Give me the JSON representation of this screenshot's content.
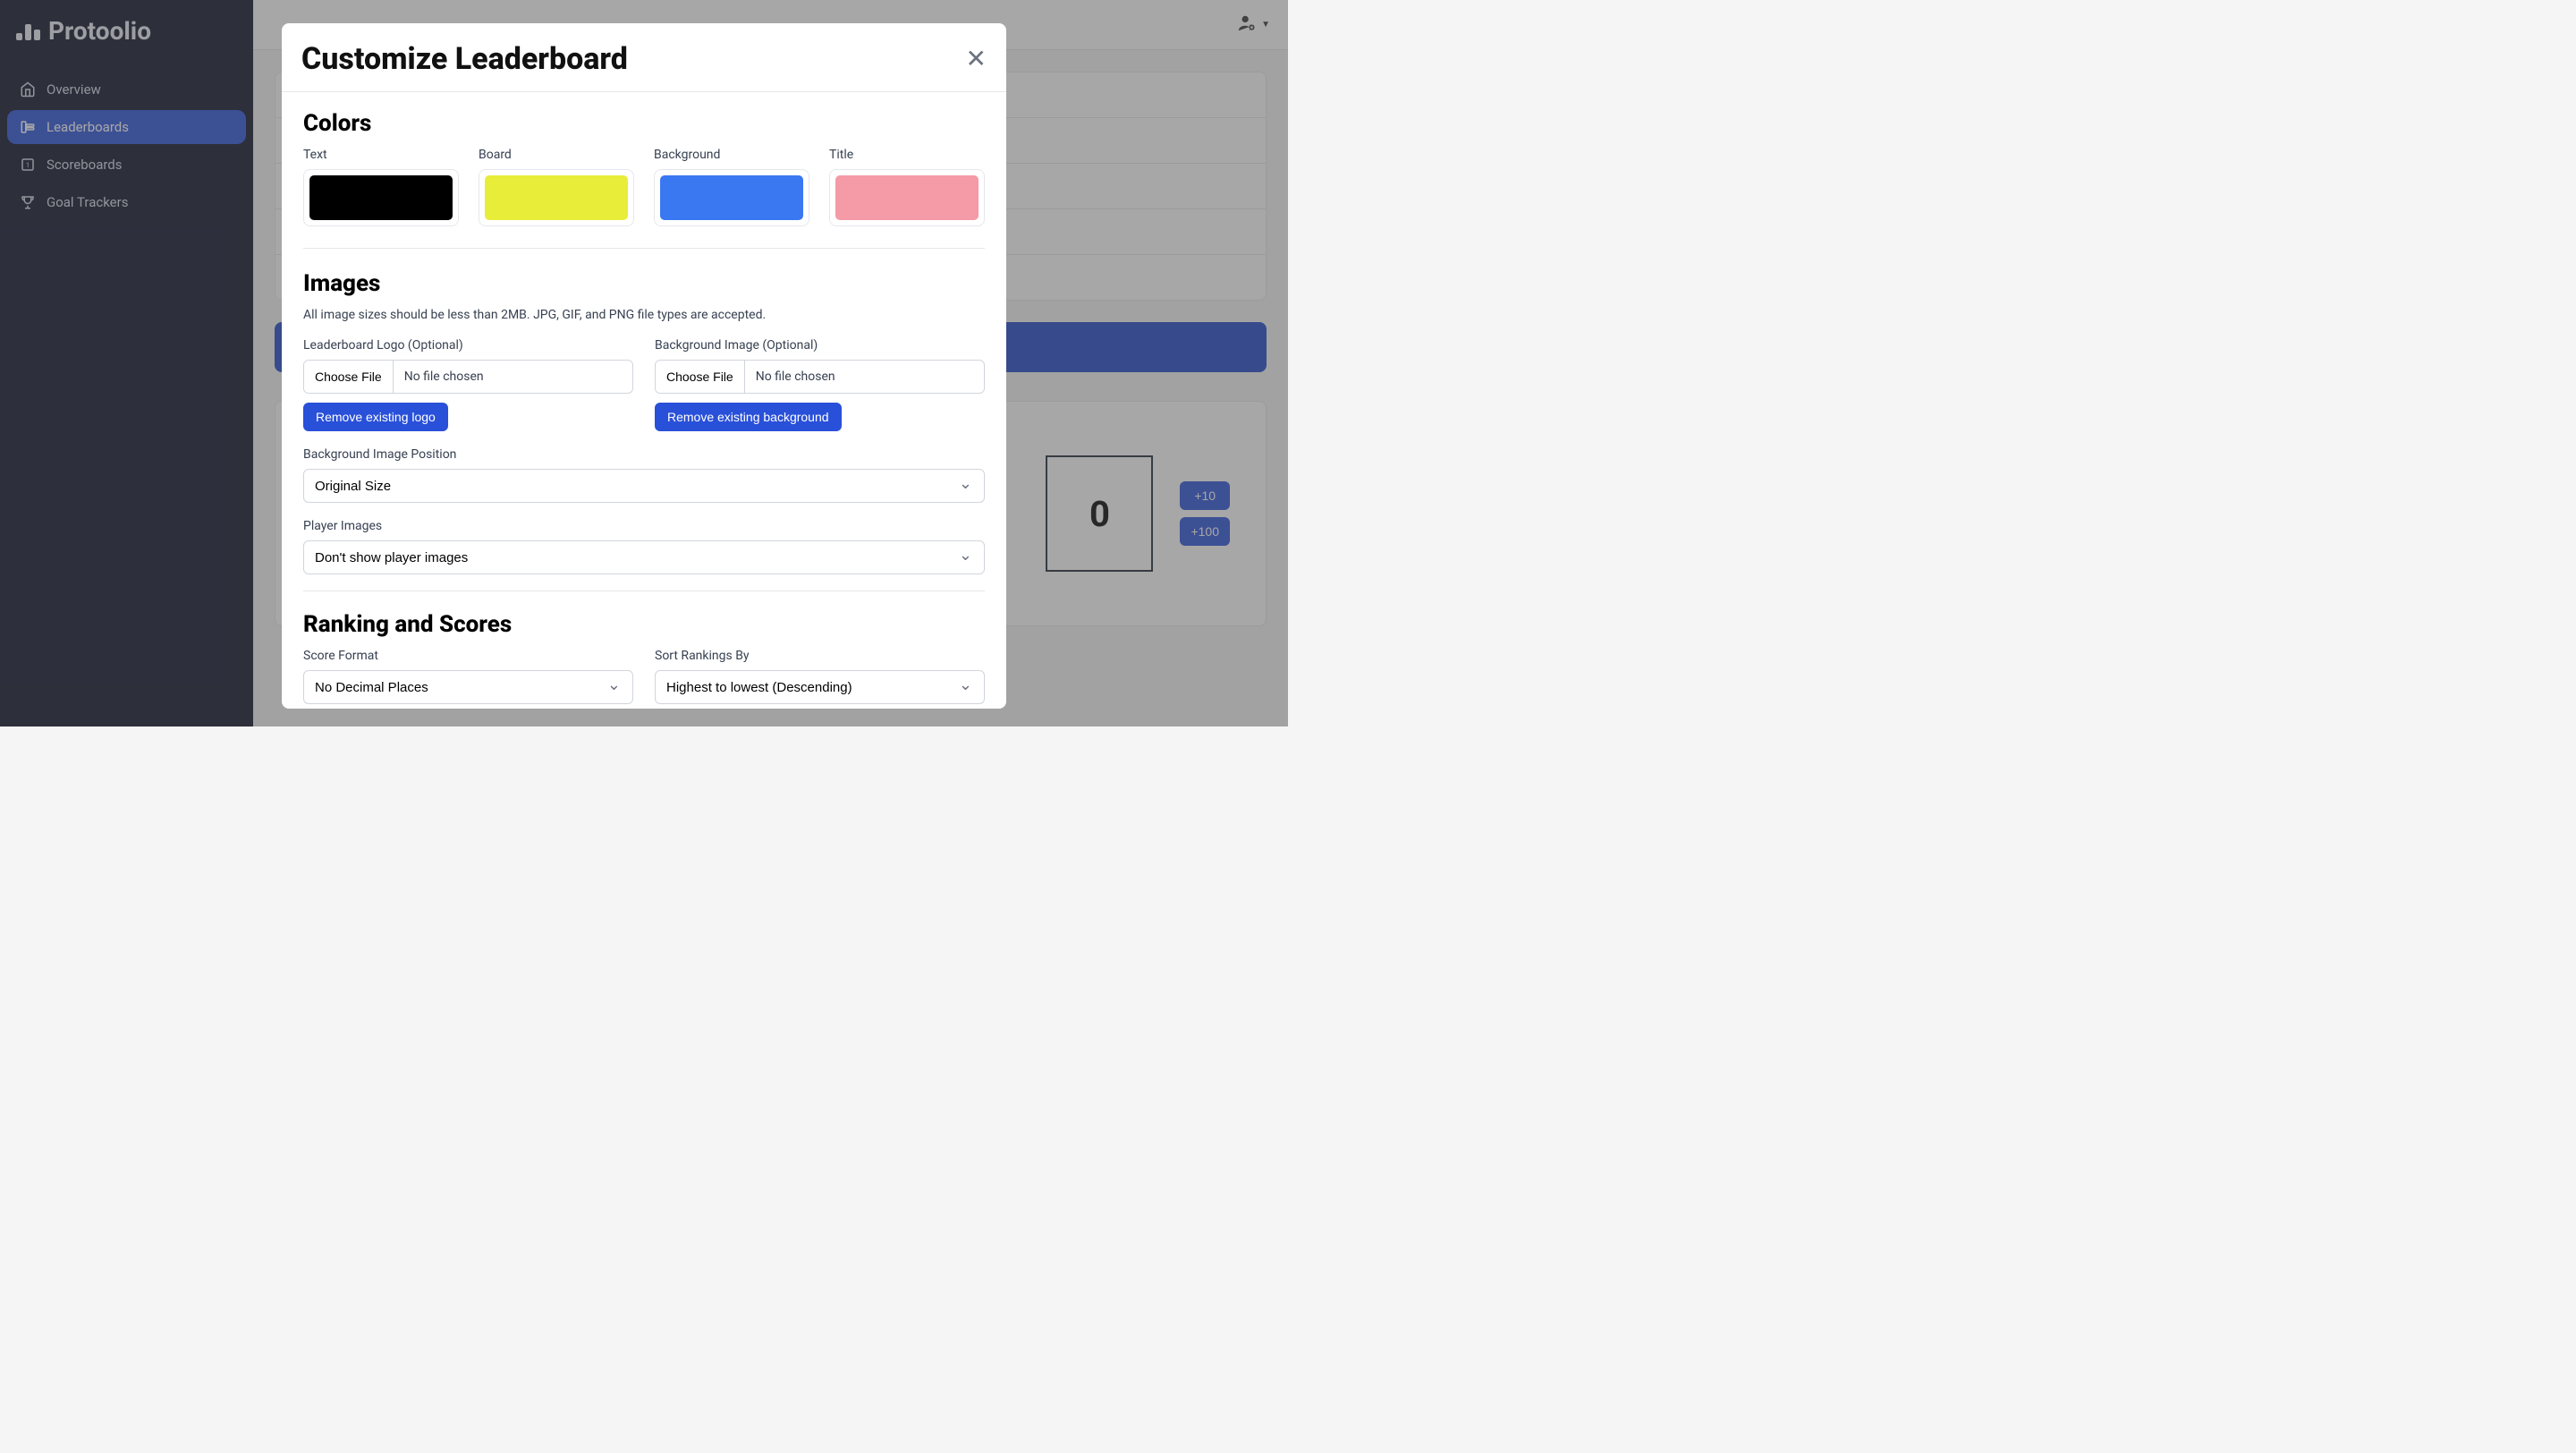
{
  "brand": "Protoolio",
  "nav": {
    "overview": "Overview",
    "leaderboards": "Leaderboards",
    "scoreboards": "Scoreboards",
    "goal_trackers": "Goal Trackers"
  },
  "score": {
    "value": "0",
    "plus10": "+10",
    "plus100": "+100"
  },
  "modal": {
    "title": "Customize Leaderboard",
    "sections": {
      "colors": "Colors",
      "images": "Images",
      "ranking": "Ranking and Scores"
    },
    "colors": {
      "text_label": "Text",
      "board_label": "Board",
      "background_label": "Background",
      "title_label": "Title",
      "text_value": "#000000",
      "board_value": "#e8ed3a",
      "background_value": "#3a78f2",
      "title_value": "#f59aa7"
    },
    "images": {
      "helper": "All image sizes should be less than 2MB. JPG, GIF, and PNG file types are accepted.",
      "logo_label": "Leaderboard Logo (Optional)",
      "bg_label": "Background Image (Optional)",
      "choose_file": "Choose File",
      "no_file": "No file chosen",
      "remove_logo": "Remove existing logo",
      "remove_bg": "Remove existing background",
      "bg_position_label": "Background Image Position",
      "bg_position_value": "Original Size",
      "player_images_label": "Player Images",
      "player_images_value": "Don't show player images"
    },
    "ranking": {
      "score_format_label": "Score Format",
      "score_format_value": "No Decimal Places",
      "sort_label": "Sort Rankings By",
      "sort_value": "Highest to lowest (Descending)"
    }
  }
}
